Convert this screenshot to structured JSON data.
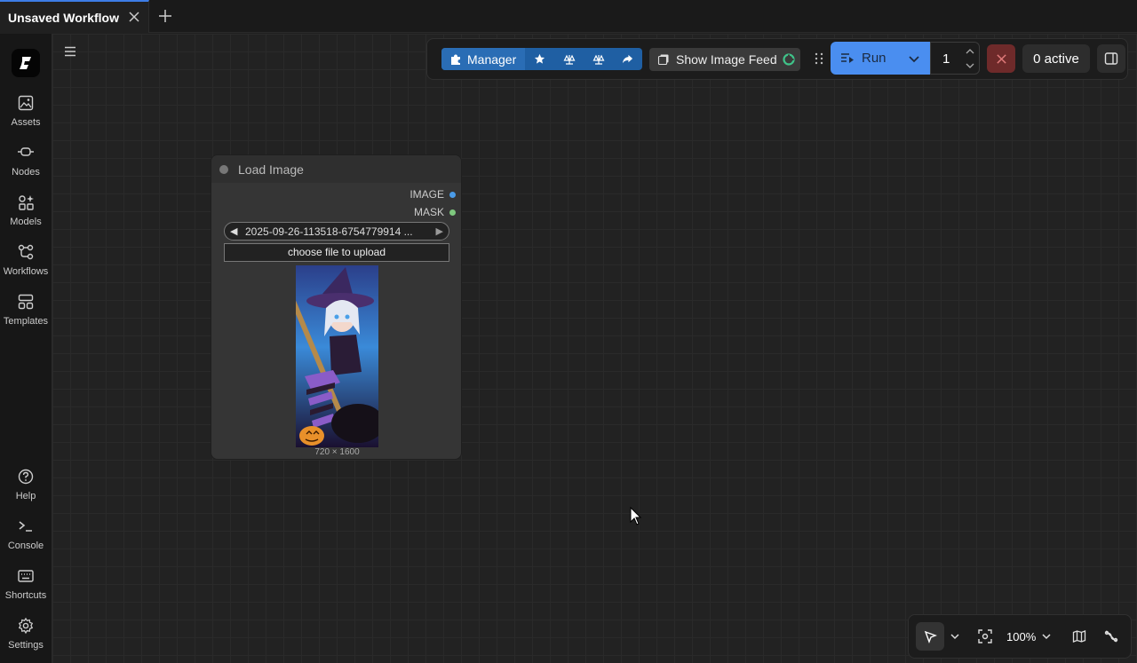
{
  "tab": {
    "title": "Unsaved Workflow"
  },
  "sidebar": {
    "items": [
      {
        "label": "Assets",
        "icon": "image-icon"
      },
      {
        "label": "Nodes",
        "icon": "node-icon"
      },
      {
        "label": "Models",
        "icon": "models-icon"
      },
      {
        "label": "Workflows",
        "icon": "workflow-icon"
      },
      {
        "label": "Templates",
        "icon": "templates-icon"
      }
    ],
    "bottom_items": [
      {
        "label": "Help",
        "icon": "help-icon"
      },
      {
        "label": "Console",
        "icon": "console-icon"
      },
      {
        "label": "Shortcuts",
        "icon": "keyboard-icon"
      },
      {
        "label": "Settings",
        "icon": "gear-icon"
      }
    ]
  },
  "toolbar": {
    "manager_label": "Manager",
    "image_feed_label": "Show Image Feed",
    "run_label": "Run",
    "batch_count": "1",
    "active_label": "0 active"
  },
  "node": {
    "title": "Load Image",
    "outputs": [
      {
        "label": "IMAGE",
        "color": "#4a9be8"
      },
      {
        "label": "MASK",
        "color": "#7ec87e"
      }
    ],
    "image_value": "2025-09-26-113518-6754779914 ...",
    "upload_label": "choose file to upload",
    "dimensions": "720 × 1600"
  },
  "canvas_controls": {
    "zoom": "100%"
  },
  "colors": {
    "accent": "#4a8ef0",
    "manager": "#2a6db5",
    "stop": "#6e2a2a"
  }
}
